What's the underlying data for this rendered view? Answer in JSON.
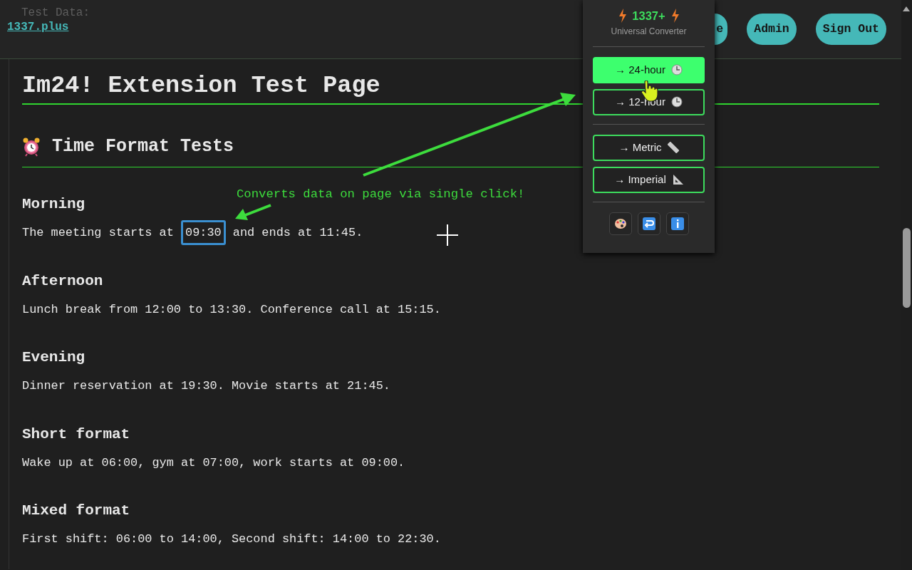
{
  "header": {
    "label": "Test Data:",
    "link": "1337.plus",
    "buttons": [
      {
        "label": "e"
      },
      {
        "label": "Admin"
      },
      {
        "label": "Sign Out"
      }
    ]
  },
  "page_title": "Im24! Extension Test Page",
  "section_title": "Time Format Tests",
  "tests": [
    {
      "heading": "Morning",
      "parts": [
        {
          "text": "The meeting starts at "
        },
        {
          "text": "09:30",
          "highlighted": true
        },
        {
          "text": " and ends at 11:45."
        }
      ]
    },
    {
      "heading": "Afternoon",
      "parts": [
        {
          "text": "Lunch break from 12:00 to 13:30. Conference call at 15:15."
        }
      ]
    },
    {
      "heading": "Evening",
      "parts": [
        {
          "text": "Dinner reservation at 19:30. Movie starts at 21:45."
        }
      ]
    },
    {
      "heading": "Short format",
      "parts": [
        {
          "text": "Wake up at 06:00, gym at 07:00, work starts at 09:00."
        }
      ]
    },
    {
      "heading": "Mixed format",
      "parts": [
        {
          "text": "First shift: 06:00 to 14:00, Second shift: 14:00 to 22:30."
        }
      ]
    }
  ],
  "annotation": {
    "text": "Converts data on page via single click!"
  },
  "popup": {
    "title": "1337+",
    "subtitle": "Universal Converter",
    "groups": [
      [
        {
          "label": "→ 24-hour",
          "kind": "clock",
          "selected": true
        },
        {
          "label": "→ 12-hour",
          "kind": "clock",
          "selected": false
        }
      ],
      [
        {
          "label": "→ Metric",
          "kind": "ruler",
          "selected": false
        },
        {
          "label": "→ Imperial",
          "kind": "triangle",
          "selected": false
        }
      ]
    ],
    "tools": [
      {
        "kind": "palette"
      },
      {
        "kind": "undo"
      },
      {
        "kind": "info"
      }
    ]
  }
}
